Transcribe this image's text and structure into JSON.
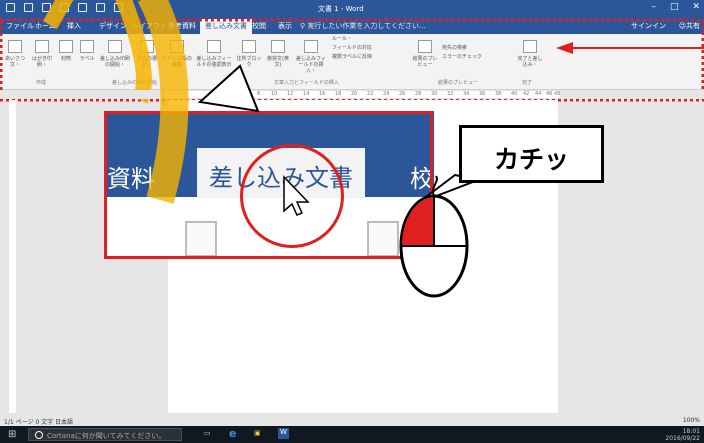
{
  "window": {
    "title": "文書 1 - Word"
  },
  "tabs": [
    "ファイル",
    "ホーム",
    "挿入",
    "デザイン",
    "レイアウト",
    "参考資料",
    "差し込み文書",
    "校閲",
    "表示"
  ],
  "tell_me": "実行したい作業を入力してください...",
  "sign_in": "サインイン",
  "share": "共有",
  "ribbon": {
    "buttons": [
      "あいさつ文・",
      "はがき印刷・",
      "封筒",
      "ラベル",
      "差し込み印刷の開始・",
      "宛先の選択・",
      "アドレス帳の編集",
      "差し込みフィールドの強調表示",
      "住所ブロック",
      "挨拶文(英文)",
      "差し込みフィールドの挿入・",
      "ルール・",
      "フィールドの対応",
      "複数ラベルに反映",
      "結果のプレビュー",
      "宛先の検索",
      "エラーのチェック",
      "完了と差し込み・"
    ],
    "groups": [
      "作成",
      "差し込み印刷の開始",
      "文章入力とフィールドの挿入",
      "結果のプレビュー",
      "完了"
    ]
  },
  "ruler": {
    "ticks": [
      "4",
      "6",
      "8",
      "10",
      "12",
      "14",
      "16",
      "18",
      "20",
      "22",
      "24",
      "26",
      "28",
      "30",
      "32",
      "34",
      "36",
      "38",
      "40",
      "42",
      "44",
      "46",
      "48"
    ]
  },
  "zoom": {
    "tab_left": "資料",
    "tab_active": "差し込み文書",
    "tab_right": "校"
  },
  "callout": {
    "text": "カチッ"
  },
  "status": {
    "left": "1/1 ページ 0 文字 日本語",
    "zoom": "100%"
  },
  "taskbar": {
    "cortana": "Cortanaに何か聞いてみてください。",
    "time": "18:01",
    "date": "2016/09/22"
  },
  "colors": {
    "word_blue": "#2b579a",
    "highlight_red": "#e02020",
    "marker_orange": "#f5b400",
    "mouse_left_button": "#e02020"
  },
  "icons": [
    "save-icon",
    "undo-icon",
    "redo-icon",
    "new-document-icon",
    "open-icon",
    "print-icon",
    "quick-access-customize-icon",
    "minimize-icon",
    "maximize-icon",
    "close-icon",
    "search-icon",
    "person-icon",
    "windows-logo-icon",
    "cortana-icon",
    "task-view-icon",
    "edge-icon",
    "explorer-icon",
    "word-icon",
    "mouse-icon",
    "mouse-cursor-icon"
  ]
}
